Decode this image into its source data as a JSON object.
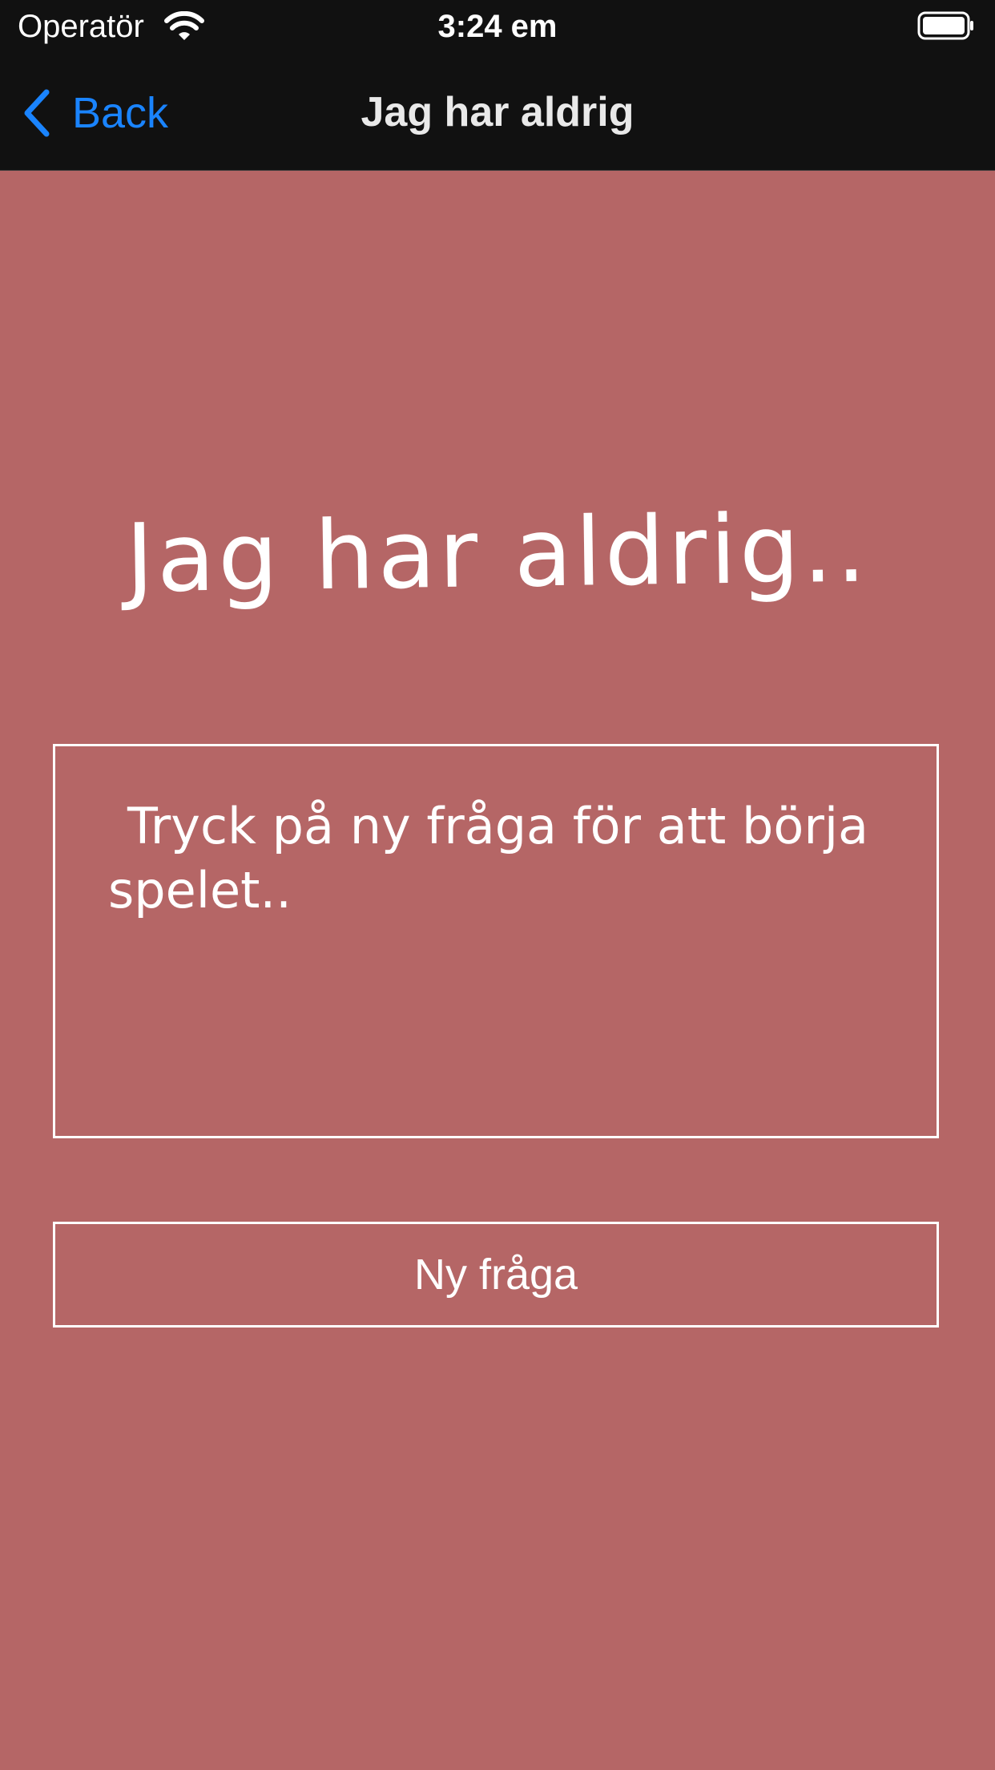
{
  "status_bar": {
    "carrier": "Operatör",
    "time": "3:24 em",
    "wifi_icon": "wifi-icon",
    "battery_icon": "battery-icon"
  },
  "nav": {
    "back_label": "Back",
    "back_icon": "chevron-left-icon",
    "title": "Jag har aldrig"
  },
  "main": {
    "heading": "Jag har aldrig..",
    "question": "Tryck på ny fråga för att börja spelet..",
    "new_question_button": "Ny fråga"
  },
  "colors": {
    "background": "#b56666",
    "bar": "#111111",
    "accent": "#1a84ff",
    "foreground": "#ffffff"
  }
}
